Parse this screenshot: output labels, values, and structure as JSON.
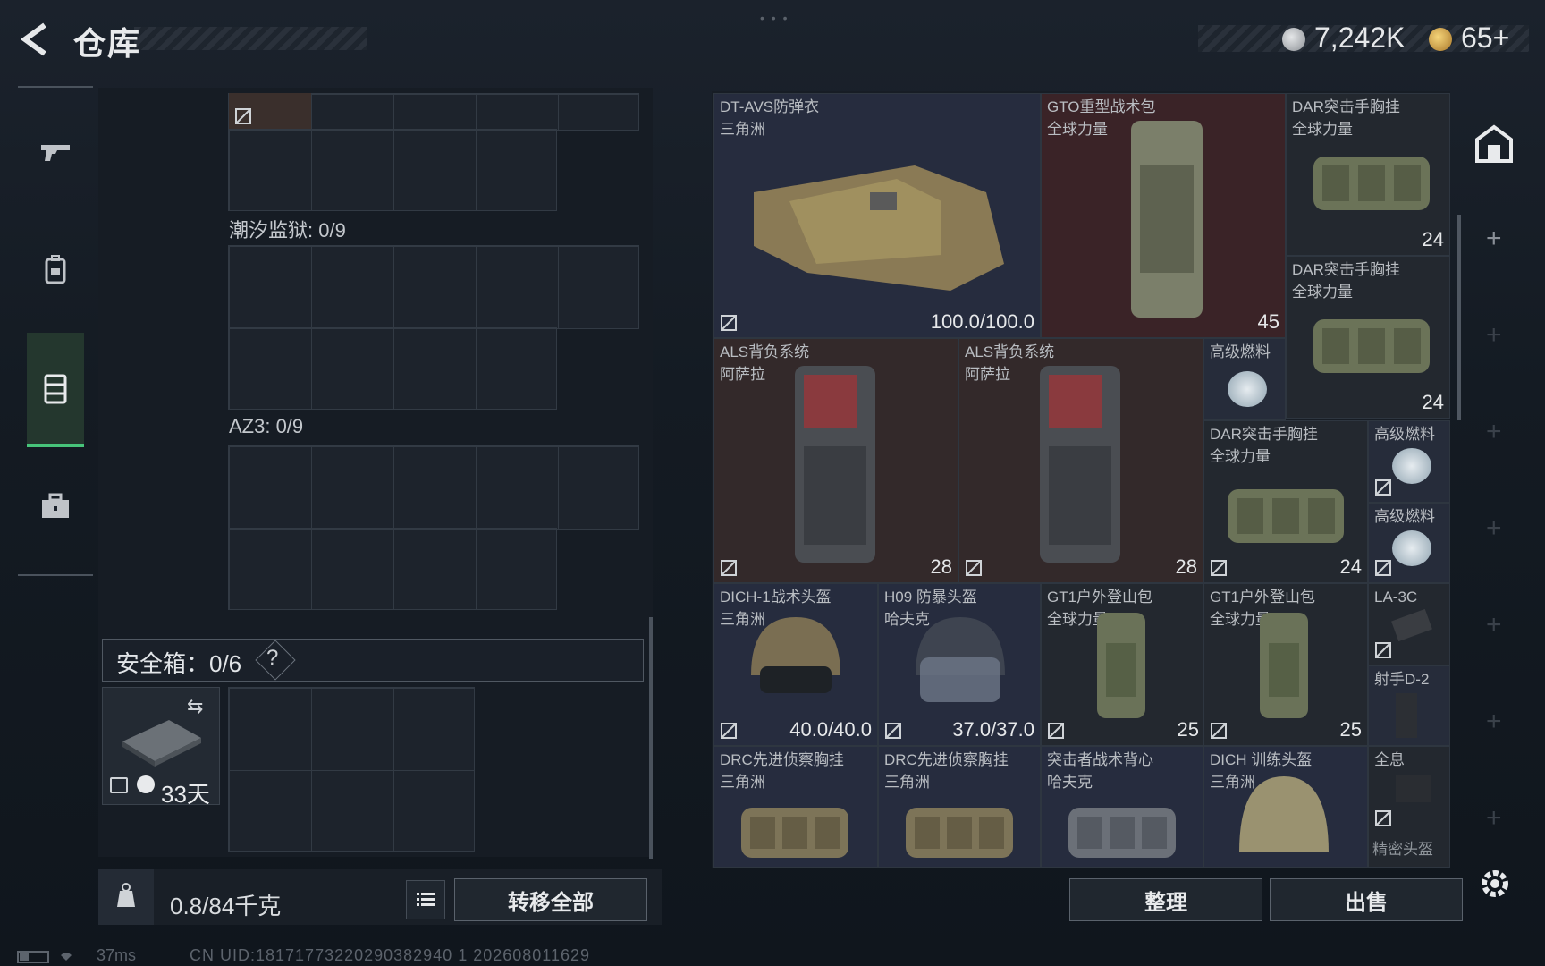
{
  "header": {
    "title": "仓库",
    "currency_silver": "7,242K",
    "currency_gold": "65+"
  },
  "nav": {
    "items": [
      {
        "name": "weapons",
        "icon": "gun-icon"
      },
      {
        "name": "gear",
        "icon": "backpack-icon"
      },
      {
        "name": "storage",
        "icon": "locker-icon",
        "selected": true
      },
      {
        "name": "toolkit",
        "icon": "toolbox-icon"
      }
    ]
  },
  "storage": {
    "containers": [
      {
        "label": "潮汐监狱: 0/9"
      },
      {
        "label": "AZ3: 0/9"
      }
    ],
    "safe_box": {
      "label": "安全箱：0/6",
      "help": "?",
      "days": "33天"
    },
    "weight": "0.8/84千克",
    "transfer_all": "转移全部"
  },
  "inventory": {
    "items": [
      {
        "name": "DT-AVS防弹衣",
        "sub": "三角洲",
        "value": "100.0/100.0"
      },
      {
        "name": "GTO重型战术包",
        "sub": "全球力量",
        "value": "45"
      },
      {
        "name": "DAR突击手胸挂",
        "sub": "全球力量",
        "value": "24"
      },
      {
        "name": "DAR突击手胸挂",
        "sub": "全球力量",
        "value": "24"
      },
      {
        "name": "ALS背负系统",
        "sub": "阿萨拉",
        "value": "28"
      },
      {
        "name": "ALS背负系统",
        "sub": "阿萨拉",
        "value": "28"
      },
      {
        "name": "高级燃料",
        "sub": "",
        "value": ""
      },
      {
        "name": "DAR突击手胸挂",
        "sub": "全球力量",
        "value": "24"
      },
      {
        "name": "高级燃料",
        "sub": "",
        "value": ""
      },
      {
        "name": "高级燃料",
        "sub": "",
        "value": ""
      },
      {
        "name": "DICH-1战术头盔",
        "sub": "三角洲",
        "value": "40.0/40.0"
      },
      {
        "name": "H09 防暴头盔",
        "sub": "哈夫克",
        "value": "37.0/37.0"
      },
      {
        "name": "GT1户外登山包",
        "sub": "全球力量",
        "value": "25"
      },
      {
        "name": "GT1户外登山包",
        "sub": "全球力量",
        "value": "25"
      },
      {
        "name": "LA-3C",
        "sub": "",
        "value": ""
      },
      {
        "name": "射手D-2",
        "sub": "",
        "value": ""
      },
      {
        "name": "DRC先进侦察胸挂",
        "sub": "三角洲",
        "value": ""
      },
      {
        "name": "DRC先进侦察胸挂",
        "sub": "三角洲",
        "value": ""
      },
      {
        "name": "突击者战术背心",
        "sub": "哈夫克",
        "value": ""
      },
      {
        "name": "DICH 训练头盔",
        "sub": "三角洲",
        "value": ""
      },
      {
        "name": "全息",
        "sub": "精密头盔",
        "value": ""
      }
    ],
    "sort": "整理",
    "sell": "出售"
  },
  "status": {
    "ping": "37ms",
    "uid": "CN UID:18171773220290382940 1 202608011629"
  },
  "colors": {
    "accent_green": "#47c47a",
    "cell_red": "#3a2327",
    "cell_blue": "#262c3e",
    "cell_brown": "#33292a"
  }
}
